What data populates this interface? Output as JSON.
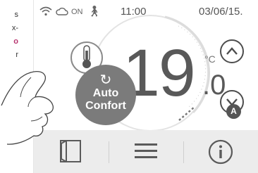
{
  "side_text": {
    "line1": "s",
    "line2": "x-",
    "line3": "o",
    "line4": "r"
  },
  "status_bar": {
    "on_label": "ON",
    "time": "11:00",
    "date": "03/06/15."
  },
  "thermostat": {
    "temp_integer": "19",
    "temp_decimal": ".0",
    "unit": "°C",
    "mode_label_line1": "Auto",
    "mode_label_line2": "Confort",
    "mode_badge": "A"
  },
  "bottom_bar": {
    "buttons": [
      "door-icon",
      "menu-icon",
      "info-icon"
    ]
  },
  "colors": {
    "text": "#595959",
    "mode_button": "#7b7b7b",
    "bottom_bar": "#ececec",
    "side_accent": "#b7356f"
  }
}
